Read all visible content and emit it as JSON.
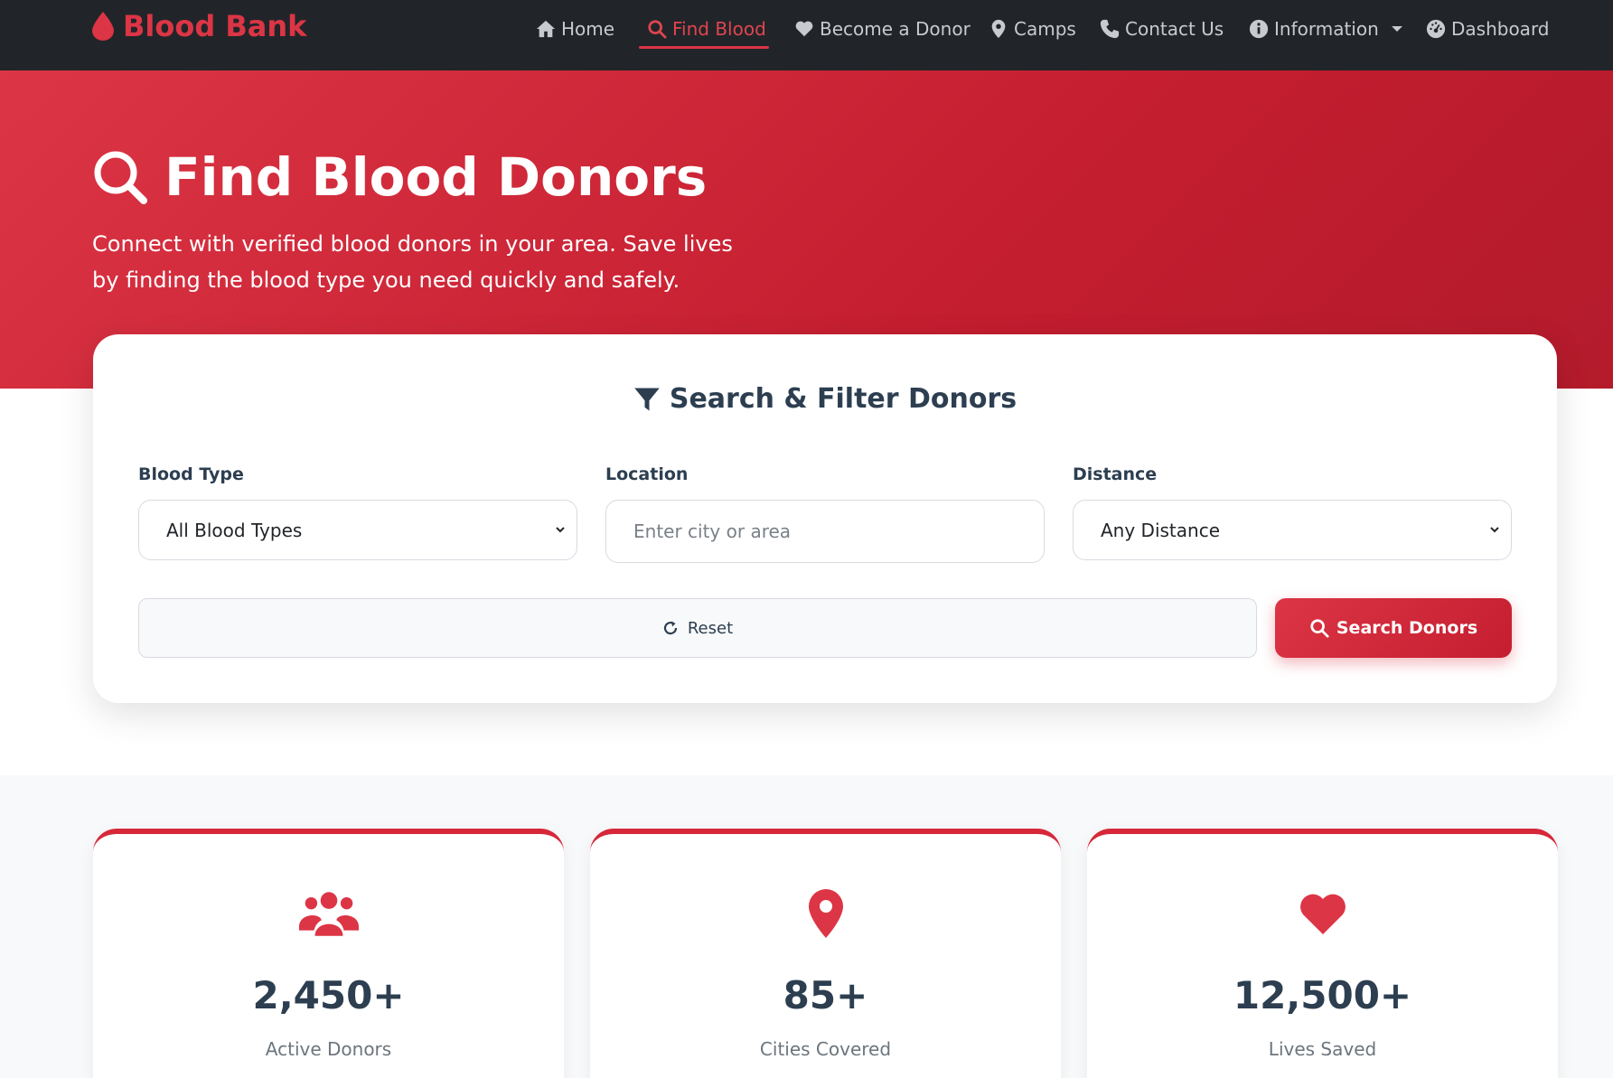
{
  "brand": {
    "name": "Blood Bank"
  },
  "nav": {
    "items": [
      {
        "label": "Home",
        "icon": "home-icon"
      },
      {
        "label": "Find Blood",
        "icon": "search-icon",
        "active": true
      },
      {
        "label": "Become a Donor",
        "icon": "heart-icon"
      },
      {
        "label": "Camps",
        "icon": "map-pin-icon"
      },
      {
        "label": "Contact Us",
        "icon": "phone-icon"
      },
      {
        "label": "Information",
        "icon": "info-icon",
        "dropdown": true
      },
      {
        "label": "Dashboard",
        "icon": "gauge-icon"
      }
    ]
  },
  "hero": {
    "title": "Find Blood Donors",
    "subtitle": "Connect with verified blood donors in your area. Save lives by finding the blood type you need quickly and safely."
  },
  "search": {
    "heading": "Search & Filter Donors",
    "blood_type": {
      "label": "Blood Type",
      "value": "All Blood Types"
    },
    "location": {
      "label": "Location",
      "placeholder": "Enter city or area"
    },
    "distance": {
      "label": "Distance",
      "value": "Any Distance"
    },
    "reset_label": "Reset",
    "search_label": "Search Donors"
  },
  "stats": [
    {
      "value": "2,450+",
      "label": "Active Donors",
      "icon": "users-icon"
    },
    {
      "value": "85+",
      "label": "Cities Covered",
      "icon": "map-pin-icon"
    },
    {
      "value": "12,500+",
      "label": "Lives Saved",
      "icon": "heart-icon"
    }
  ],
  "colors": {
    "accent": "#dc3545",
    "navbar": "#212529",
    "text": "#2c3e50"
  }
}
